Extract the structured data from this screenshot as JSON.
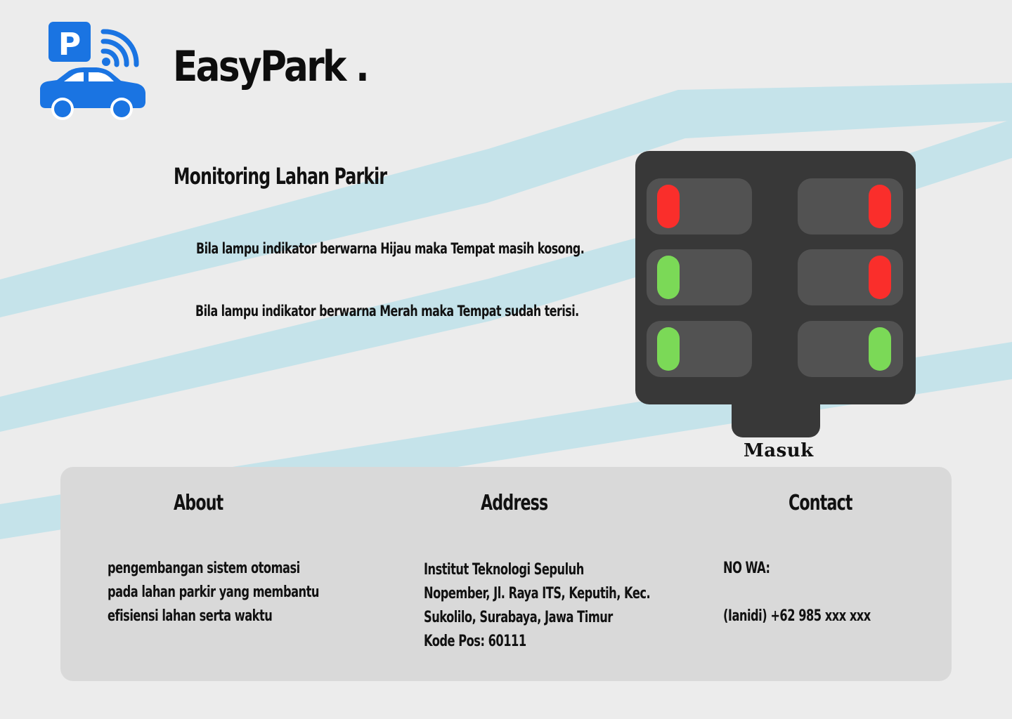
{
  "brand": {
    "name": "EasyPark .",
    "logo_icon": "parking-car-signal-icon",
    "logo_color": "#1a74e2",
    "parking_badge_letter": "P"
  },
  "main": {
    "title": "Monitoring Lahan Parkir",
    "info_green": "Bila lampu indikator berwarna Hijau maka Tempat masih kosong.",
    "info_red": "Bila lampu indikator berwarna Merah maka Tempat sudah terisi."
  },
  "parking_map": {
    "entrance_label": "Masuk",
    "colors": {
      "occupied": "#fa2e2b",
      "empty": "#7bd957"
    },
    "slots": [
      {
        "side": "left",
        "row": 1,
        "status": "occupied"
      },
      {
        "side": "right",
        "row": 1,
        "status": "occupied"
      },
      {
        "side": "left",
        "row": 2,
        "status": "empty"
      },
      {
        "side": "right",
        "row": 2,
        "status": "occupied"
      },
      {
        "side": "left",
        "row": 3,
        "status": "empty"
      },
      {
        "side": "right",
        "row": 3,
        "status": "empty"
      }
    ]
  },
  "footer": {
    "about": {
      "title": "About",
      "lines": [
        "pengembangan sistem otomasi",
        "pada lahan parkir yang membantu",
        "efisiensi lahan serta waktu"
      ]
    },
    "address": {
      "title": "Address",
      "lines": [
        "Institut Teknologi Sepuluh",
        "Nopember, Jl. Raya ITS, Keputih, Kec.",
        "Sukolilo, Surabaya, Jawa Timur",
        "Kode Pos: 60111"
      ]
    },
    "contact": {
      "title": "Contact",
      "wa_label": "NO WA:",
      "wa_number": "(Ianidi) +62 985 xxx xxx"
    }
  }
}
